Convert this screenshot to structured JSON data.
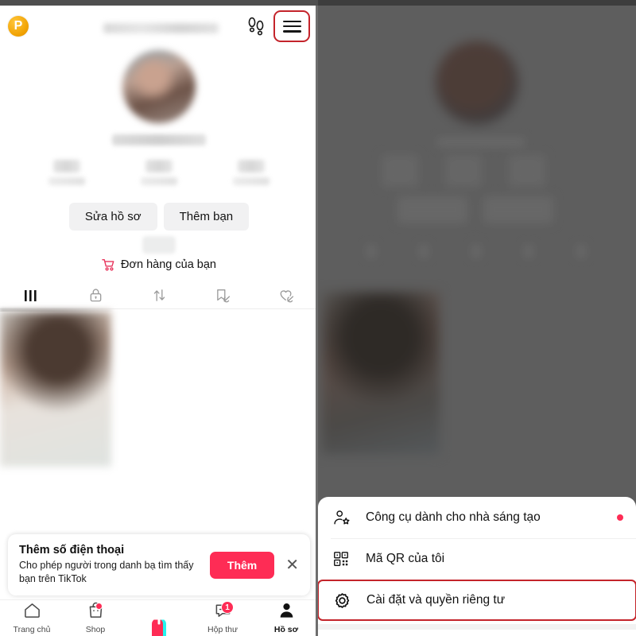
{
  "app": {
    "name": "TikTok",
    "watermark_badge": "P"
  },
  "left_panel": {
    "header": {
      "footprints_icon": "footprints-icon",
      "menu_icon": "hamburger-menu-icon",
      "highlight_color": "#c4242b"
    },
    "profile": {
      "edit_profile_label": "Sửa hồ sơ",
      "add_friends_label": "Thêm bạn",
      "orders_label": "Đơn hàng của bạn",
      "orders_icon": "shopping-cart-icon"
    },
    "tabs": [
      {
        "name": "posts",
        "icon": "grid-icon",
        "active": true
      },
      {
        "name": "private",
        "icon": "lock-icon",
        "active": false
      },
      {
        "name": "reposts",
        "icon": "repost-arrows-icon",
        "active": false
      },
      {
        "name": "saved",
        "icon": "bookmark-hidden-icon",
        "active": false
      },
      {
        "name": "liked",
        "icon": "heart-hidden-icon",
        "active": false
      }
    ],
    "banner": {
      "title": "Thêm số điện thoại",
      "subtitle": "Cho phép người trong danh bạ tìm thấy bạn trên TikTok",
      "action_label": "Thêm",
      "close_icon": "close-icon",
      "action_color": "#fe2c55"
    },
    "bottom_nav": [
      {
        "label": "Trang chủ",
        "icon": "home-icon",
        "badge": "",
        "active": false
      },
      {
        "label": "Shop",
        "icon": "shopping-bag-icon",
        "badge": "dot",
        "active": false
      },
      {
        "label": "",
        "icon": "create-plus-icon",
        "badge": "",
        "active": false
      },
      {
        "label": "Hộp thư",
        "icon": "inbox-message-icon",
        "badge": "1",
        "active": false
      },
      {
        "label": "Hồ sơ",
        "icon": "person-icon",
        "badge": "",
        "active": true
      }
    ]
  },
  "right_panel": {
    "menu_items": [
      {
        "label": "Công cụ dành cho nhà sáng tạo",
        "icon": "person-star-icon",
        "badge_dot": true,
        "highlighted": false
      },
      {
        "label": "Mã QR của tôi",
        "icon": "qr-code-icon",
        "badge_dot": false,
        "highlighted": false
      },
      {
        "label": "Cài đặt và quyền riêng tư",
        "icon": "gear-icon",
        "badge_dot": false,
        "highlighted": true
      }
    ],
    "highlight_color": "#c4242b",
    "overlay": "dimmed-blurred-profile"
  }
}
